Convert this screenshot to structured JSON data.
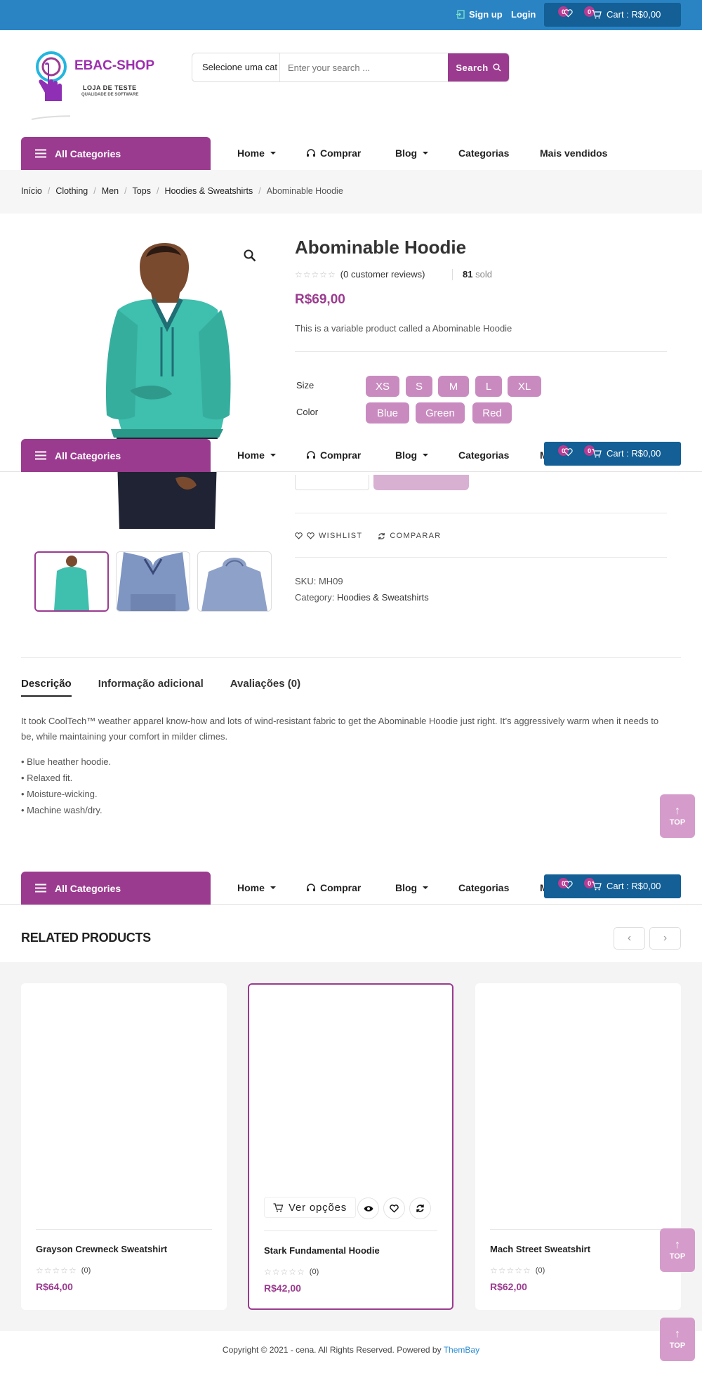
{
  "topbar": {
    "signup": "Sign up",
    "login": "Login",
    "wishlist_count": "0",
    "cart_count": "0",
    "cart_label": "Cart : R$0,00"
  },
  "logo": {
    "name": "EBAC-SHOP",
    "line1": "LOJA DE TESTE",
    "line2": "QUALIDADE DE SOFTWARE"
  },
  "search": {
    "category": "Selecione uma cat",
    "placeholder": "Enter your search ...",
    "button": "Search"
  },
  "nav": {
    "all_categories": "All Categories",
    "home": "Home",
    "comprar": "Comprar",
    "blog": "Blog",
    "categorias": "Categorias",
    "mais_vendidos": "Mais vendidos",
    "mais_vendidos_clipped": "M"
  },
  "breadcrumb": [
    "Início",
    "Clothing",
    "Men",
    "Tops",
    "Hoodies & Sweatshirts",
    "Abominable Hoodie"
  ],
  "product": {
    "title": "Abominable Hoodie",
    "stars": "☆☆☆☆☆",
    "reviews": "(0 customer reviews)",
    "sold_count": "81",
    "sold_label": "sold",
    "price": "R$69,00",
    "short_description": "This is a variable product called a Abominable Hoodie",
    "size_label": "Size",
    "sizes": [
      "XS",
      "S",
      "M",
      "L",
      "XL"
    ],
    "color_label": "Color",
    "colors": [
      "Blue",
      "Green",
      "Red"
    ],
    "wishlist": "WISHLIST",
    "compare": "COMPARAR",
    "sku_label": "SKU:",
    "sku": "MH09",
    "category_label": "Category:",
    "category": "Hoodies & Sweatshirts",
    "shirt_color": "#3fbfae"
  },
  "tabs": [
    "Descrição",
    "Informação adicional",
    "Avaliações (0)"
  ],
  "description": {
    "paragraph": "It took CoolTech™ weather apparel know-how and lots of wind-resistant fabric to get the Abominable Hoodie just right. It’s aggressively warm when it needs to be, while maintaining your comfort in milder climes.",
    "bullets": [
      "• Blue heather hoodie.",
      "• Relaxed fit.",
      "• Moisture-wicking.",
      "• Machine wash/dry."
    ]
  },
  "top_button": "TOP",
  "related": {
    "heading": "RELATED PRODUCTS",
    "prev": "‹",
    "next": "›",
    "ver_opcoes": "Ver opções",
    "products": [
      {
        "name": "Grayson Crewneck Sweatshirt",
        "stars": "☆☆☆☆☆",
        "reviews": "(0)",
        "price": "R$64,00"
      },
      {
        "name": "Stark Fundamental Hoodie",
        "stars": "☆☆☆☆☆",
        "reviews": "(0)",
        "price": "R$42,00"
      },
      {
        "name": "Mach Street Sweatshirt",
        "stars": "☆☆☆☆☆",
        "reviews": "(0)",
        "price": "R$62,00"
      }
    ]
  },
  "footer": {
    "text": "Copyright © 2021 - cena. All Rights Reserved. Powered by ",
    "brand": "ThemBay"
  },
  "colors": {
    "topbar": "#2a84c4",
    "accent": "#9b3b8f",
    "chip": "#c98bbf",
    "cart_box": "#135f96"
  }
}
